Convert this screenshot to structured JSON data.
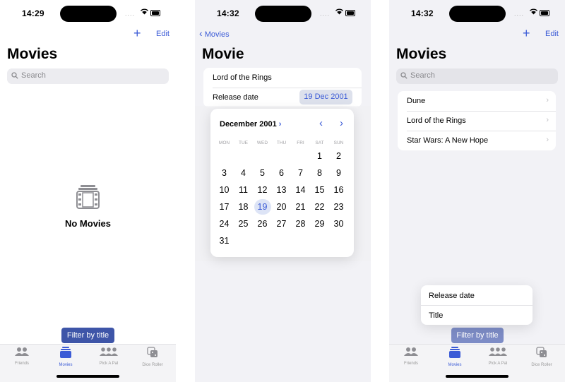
{
  "colors": {
    "accent": "#3b5bd6",
    "filter_button": "#3e55a8",
    "filter_button_faded": "#7d8cc6"
  },
  "tabs": [
    {
      "label": "Friends",
      "icon": "friends-icon"
    },
    {
      "label": "Movies",
      "icon": "movies-icon"
    },
    {
      "label": "Pick A Pal",
      "icon": "pick-a-pal-icon"
    },
    {
      "label": "Dice Roller",
      "icon": "dice-icon"
    }
  ],
  "screen1": {
    "time": "14:29",
    "add_label": "+",
    "edit_label": "Edit",
    "title": "Movies",
    "search_placeholder": "Search",
    "empty_title": "No Movies",
    "filter_label": "Filter by title"
  },
  "screen2": {
    "time": "14:32",
    "back_label": "Movies",
    "title": "Movie",
    "movie_title": "Lord of the Rings",
    "release_label": "Release date",
    "release_value": "19 Dec 2001",
    "calendar": {
      "month_label": "December 2001",
      "month_chevron": "›",
      "prev": "‹",
      "next": "›",
      "weekdays": [
        "MON",
        "TUE",
        "WED",
        "THU",
        "FRI",
        "SAT",
        "SUN"
      ],
      "days": [
        "1",
        "2",
        "3",
        "4",
        "5",
        "6",
        "7",
        "8",
        "9",
        "10",
        "11",
        "12",
        "13",
        "14",
        "15",
        "16",
        "17",
        "18",
        "19",
        "20",
        "21",
        "22",
        "23",
        "24",
        "25",
        "26",
        "27",
        "28",
        "29",
        "30",
        "31"
      ],
      "selected_day": "19"
    }
  },
  "screen3": {
    "time": "14:32",
    "add_label": "+",
    "edit_label": "Edit",
    "title": "Movies",
    "search_placeholder": "Search",
    "movies": [
      "Dune",
      "Lord of the Rings",
      "Star Wars: A New Hope"
    ],
    "chevron": "›",
    "menu_items": [
      "Release date",
      "Title"
    ],
    "filter_label": "Filter by title"
  }
}
